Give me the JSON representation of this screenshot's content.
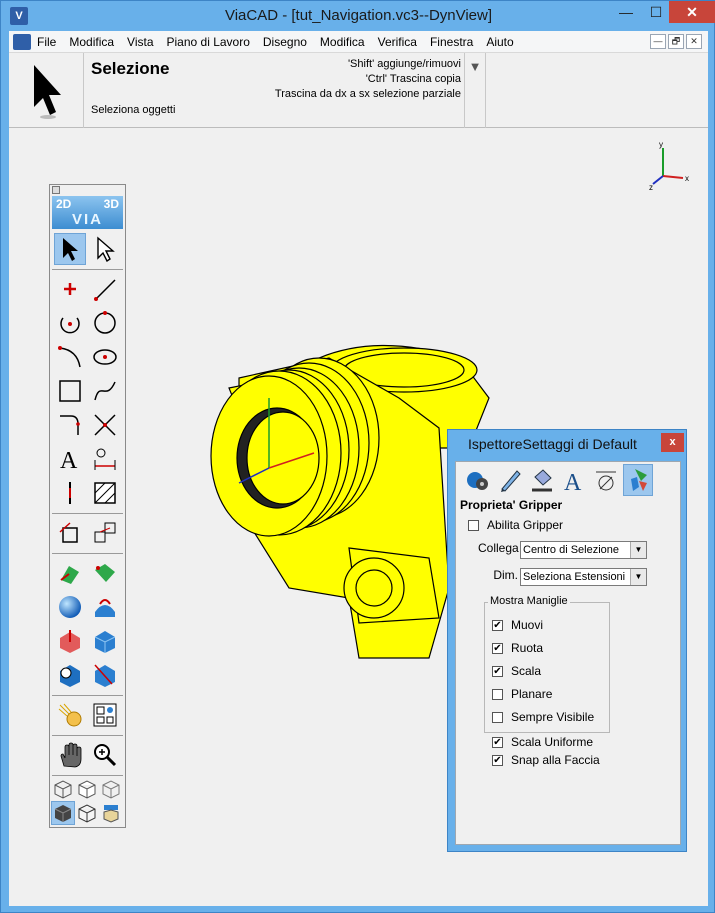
{
  "window": {
    "title": "ViaCAD - [tut_Navigation.vc3--DynView]",
    "app_icon": "viacad-logo-icon",
    "min_glyph": "—",
    "max_glyph": "☐",
    "close_glyph": "✕"
  },
  "menubar": {
    "items": [
      "File",
      "Modifica",
      "Vista",
      "Piano di Lavoro",
      "Disegno",
      "Modifica",
      "Verifica",
      "Finestra",
      "Aiuto"
    ],
    "mdi_min": "—",
    "mdi_restore": "🗗",
    "mdi_close": "✕"
  },
  "context": {
    "title": "Selezione",
    "subtitle": "Seleziona oggetti",
    "hints": [
      "'Shift' aggiunge/rimuovi",
      "'Ctrl' Trascina copia",
      "Trascina da dx a sx selezione parziale"
    ],
    "dropdown_glyph": "▼"
  },
  "axis": {
    "y": "y",
    "x": "x",
    "z": "z"
  },
  "palette": {
    "logo_2d": "2D",
    "logo_3d": "3D",
    "logo_via": "VIA",
    "model_color": "#ffff00",
    "accent": "#9cc7ee"
  },
  "inspector": {
    "title": "IspettoreSettaggi di Default",
    "close_glyph": "x",
    "heading": "Proprieta' Gripper",
    "abilita_gripper": {
      "label": "Abilita Gripper",
      "checked": false
    },
    "collega_label": "Collega",
    "collega_value": "Centro di Selezione",
    "dim_label": "Dim.",
    "dim_value": "Seleziona Estensioni",
    "group_label": "Mostra Maniglie",
    "handles": [
      {
        "label": "Muovi",
        "checked": true
      },
      {
        "label": "Ruota",
        "checked": true
      },
      {
        "label": "Scala",
        "checked": true
      },
      {
        "label": "Planare",
        "checked": false
      },
      {
        "label": "Sempre Visibile",
        "checked": false
      }
    ],
    "scala_uniforme": {
      "label": "Scala Uniforme",
      "checked": true
    },
    "snap_faccia": {
      "label": "Snap alla Faccia",
      "checked": true
    },
    "check_glyph": "✔",
    "dropdown_glyph": "▼"
  }
}
